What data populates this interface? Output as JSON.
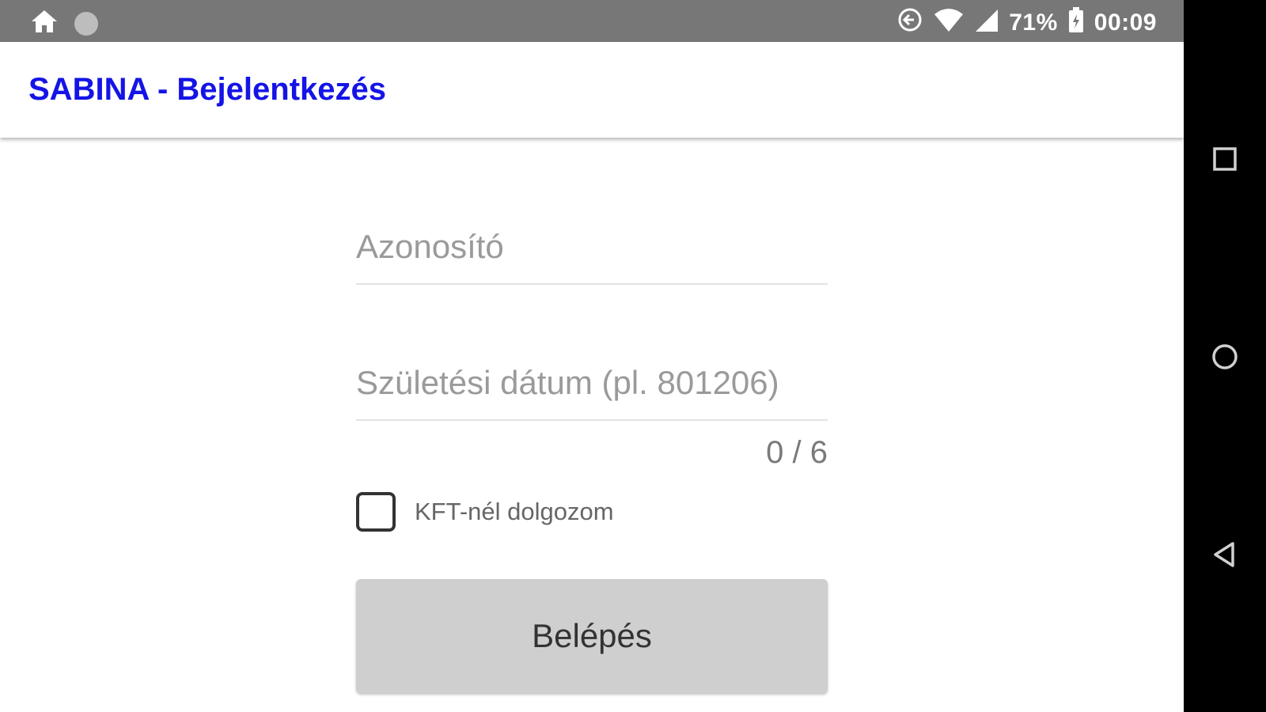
{
  "status_bar": {
    "icons": [
      "home-icon",
      "notification-dot-icon",
      "sync-icon",
      "wifi-icon",
      "cellular-signal-icon",
      "battery-icon"
    ],
    "battery": "71%",
    "time": "00:09",
    "color": "#777777"
  },
  "app_bar": {
    "title": "SABINA - Bejelentkezés",
    "title_color": "#1414e6"
  },
  "login_form": {
    "id_field": {
      "placeholder": "Azonosító",
      "value": ""
    },
    "birthdate_field": {
      "placeholder": "Születési dátum (pl. 801206)",
      "value": ""
    },
    "char_counter": "0 / 6",
    "kft_checkbox": {
      "label": "KFT-nél dolgozom",
      "checked": false
    },
    "submit_button": {
      "label": "Belépés",
      "enabled": false
    }
  },
  "nav_bar": {
    "icons": [
      "recent-apps-icon",
      "home-circle-icon",
      "back-icon"
    ]
  }
}
